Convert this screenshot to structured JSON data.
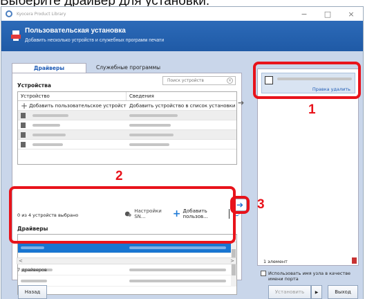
{
  "caption": "Выберите драйвер для установки.",
  "window": {
    "title": "Kyocera Product Library",
    "controls": {
      "minimize": "−",
      "maximize": "□",
      "close": "×"
    }
  },
  "header": {
    "title": "Пользовательская установка",
    "subtitle": "Добавить несколько устройств и служебных программ печати"
  },
  "tabs": [
    {
      "label": "Драйверы",
      "active": true
    },
    {
      "label": "Служебные программы",
      "active": false
    }
  ],
  "devices": {
    "section_label": "Устройства",
    "search_placeholder": "Поиск устройств",
    "columns": [
      "Устройство",
      "Сведения"
    ],
    "add_row": {
      "device": "Добавить пользовательское устройст...",
      "info": "Добавить устройство в список установки"
    },
    "selected_count": "0 из 4 устройств выбрано",
    "snmp_label": "Настройки SN...",
    "add_custom_label": "Добавить пользов..."
  },
  "drivers": {
    "section_label": "Драйверы",
    "count": "7 драйверов"
  },
  "install_list": {
    "item_links": "Правка  удалить",
    "item_count": "1 элемент",
    "use_hostname_label": "Использовать имя узла в качестве имени порта"
  },
  "buttons": {
    "back": "Назад",
    "install": "Установить",
    "install_menu": "▶",
    "exit": "Выход"
  },
  "callouts": [
    "1",
    "2",
    "3"
  ],
  "colors": {
    "header_blue": "#1f5aa6",
    "selection_blue": "#1875d1",
    "callout_red": "#e8131b",
    "body_bg": "#c9d6ea"
  }
}
